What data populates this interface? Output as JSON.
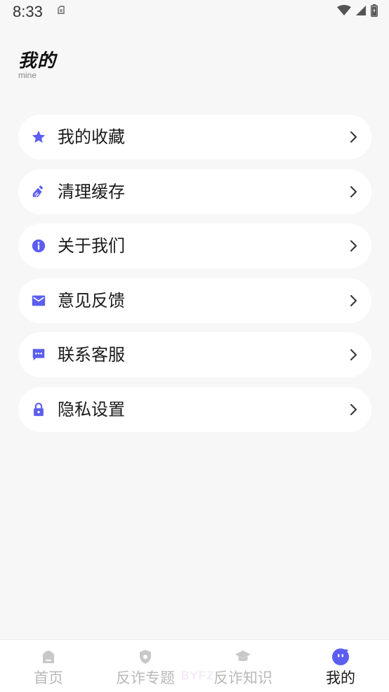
{
  "status_bar": {
    "time": "8:33",
    "icons": [
      "notification-icon",
      "wifi-icon",
      "cell-signal-icon",
      "battery-icon"
    ]
  },
  "header": {
    "title": "我的",
    "subtitle": "mine"
  },
  "menu": {
    "items": [
      {
        "label": "我的收藏",
        "icon": "star-icon"
      },
      {
        "label": "清理缓存",
        "icon": "broom-icon"
      },
      {
        "label": "关于我们",
        "icon": "info-icon"
      },
      {
        "label": "意见反馈",
        "icon": "mail-icon"
      },
      {
        "label": "联系客服",
        "icon": "chat-icon"
      },
      {
        "label": "隐私设置",
        "icon": "lock-icon"
      }
    ]
  },
  "bottom_nav": {
    "items": [
      {
        "label": "首页",
        "icon": "home-icon",
        "active": false
      },
      {
        "label": "反诈专题",
        "icon": "shield-icon",
        "active": false
      },
      {
        "label": "反诈知识",
        "icon": "graduation-cap-icon",
        "active": false
      },
      {
        "label": "我的",
        "icon": "profile-icon",
        "active": true
      }
    ],
    "watermark": "BYFZ"
  },
  "colors": {
    "accent": "#5b5ef0",
    "background": "#f7f7f8",
    "card": "#ffffff",
    "inactive_nav": "#b8b8b8"
  }
}
